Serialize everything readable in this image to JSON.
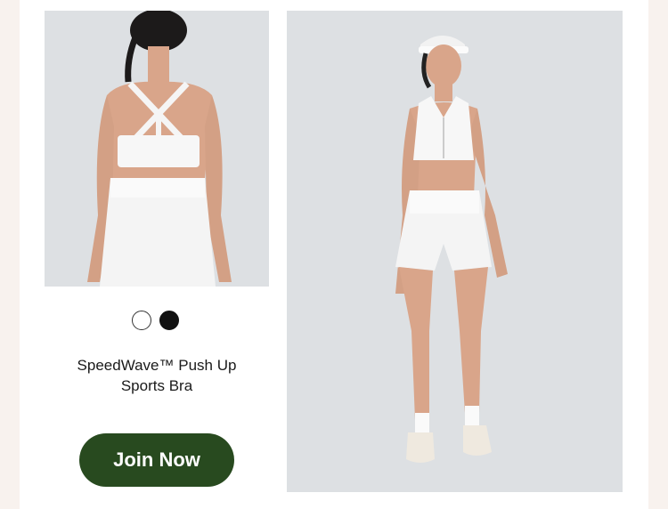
{
  "product": {
    "name_line1": "SpeedWave™ Push Up",
    "name_line2": "Sports Bra",
    "swatches": [
      {
        "name": "White",
        "color": "#ffffff"
      },
      {
        "name": "Black",
        "color": "#111111"
      }
    ]
  },
  "cta": {
    "label": "Join Now",
    "color": "#284a1f"
  },
  "colors": {
    "page_bg": "#f8f2ee",
    "card_bg": "#ffffff",
    "photo_bg": "#dde0e3"
  }
}
